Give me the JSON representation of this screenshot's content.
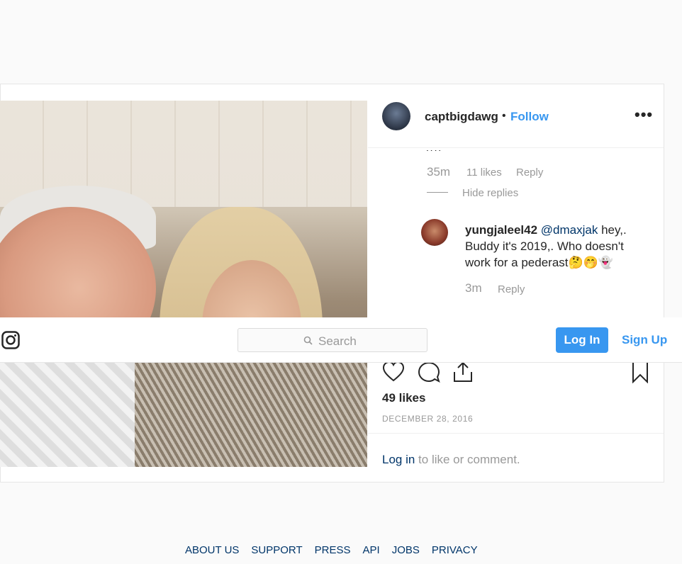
{
  "post": {
    "username": "captbigdawg",
    "follow_label": "Follow",
    "more_label": "•••",
    "separator": "•",
    "comment1": {
      "time": "35m",
      "likes": "11 likes",
      "reply_label": "Reply",
      "hide_replies": "Hide replies"
    },
    "reply": {
      "username": "yungjaleel42",
      "mention": "@dmaxjak",
      "text": " hey,. Buddy it's 2019,. Who doesn't work for a pederast🤔🤭👻",
      "time": "3m",
      "reply_label": "Reply"
    },
    "likes_count": "49 likes",
    "date": "DECEMBER 28, 2016",
    "login_link": "Log in",
    "login_suffix": " to like or comment."
  },
  "topbar": {
    "search_placeholder": "Search",
    "login_label": "Log In",
    "signup_label": "Sign Up"
  },
  "footer": {
    "links": [
      "ABOUT US",
      "SUPPORT",
      "PRESS",
      "API",
      "JOBS",
      "PRIVACY"
    ]
  },
  "icons": {
    "logo": "instagram-glyph-icon",
    "heart": "heart-icon",
    "comment": "comment-icon",
    "share": "share-icon",
    "bookmark": "bookmark-icon",
    "search": "search-icon"
  },
  "colors": {
    "accent": "#3897f0",
    "link": "#003569",
    "muted": "#999999"
  }
}
